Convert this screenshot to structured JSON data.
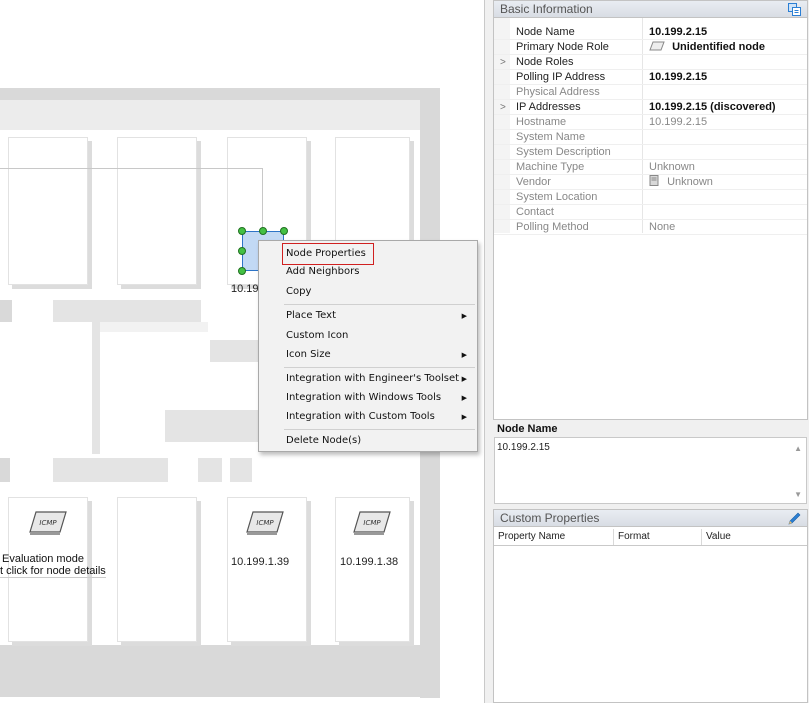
{
  "map": {
    "nodes": [
      {
        "label": "10.19",
        "selected": true
      },
      {
        "label": "10.199.1.39",
        "icon": "ICMP"
      },
      {
        "label": "10.199.1.38",
        "icon": "ICMP"
      },
      {
        "label": "",
        "icon": "ICMP"
      }
    ],
    "eval_line1": "Evaluation mode",
    "eval_line2": "t click for node details"
  },
  "context_menu": {
    "items": [
      {
        "label": "Node Properties",
        "highlighted": true,
        "submenu": false
      },
      {
        "label": "Add Neighbors",
        "submenu": false
      },
      {
        "label": "Copy",
        "submenu": false
      },
      {
        "label": "Place Text",
        "submenu": true
      },
      {
        "label": "Custom Icon",
        "submenu": false
      },
      {
        "label": "Icon Size",
        "submenu": true
      },
      {
        "label": "Integration with Engineer's Toolset",
        "submenu": true
      },
      {
        "label": "Integration with Windows Tools",
        "submenu": true
      },
      {
        "label": "Integration with Custom Tools",
        "submenu": true
      },
      {
        "label": "Delete Node(s)",
        "submenu": false
      }
    ],
    "submenu_arrow": "▶"
  },
  "basic_info": {
    "title": "Basic Information",
    "rows": [
      {
        "name": "Node Name",
        "value": "10.199.2.15",
        "expand": "",
        "style": "b"
      },
      {
        "name": "Primary Node Role",
        "value": "Unidentified node",
        "expand": "",
        "style": "b"
      },
      {
        "name": "Node Roles",
        "value": "",
        "expand": ">",
        "style": "n"
      },
      {
        "name": "Polling IP Address",
        "value": "10.199.2.15",
        "expand": "",
        "style": "b"
      },
      {
        "name": "Physical Address",
        "value": "",
        "expand": "",
        "style": "g"
      },
      {
        "name": "IP Addresses",
        "value": "10.199.2.15 (discovered)",
        "expand": ">",
        "style": "b"
      },
      {
        "name": "Hostname",
        "value": "10.199.2.15",
        "expand": "",
        "style": "g"
      },
      {
        "name": "System Name",
        "value": "",
        "expand": "",
        "style": "g"
      },
      {
        "name": "System Description",
        "value": "",
        "expand": "",
        "style": "g"
      },
      {
        "name": "Machine Type",
        "value": "Unknown",
        "expand": "",
        "style": "g"
      },
      {
        "name": "Vendor",
        "value": "Unknown",
        "expand": "",
        "style": "g"
      },
      {
        "name": "System Location",
        "value": "",
        "expand": "",
        "style": "g"
      },
      {
        "name": "Contact",
        "value": "",
        "expand": "",
        "style": "g"
      },
      {
        "name": "Polling Method",
        "value": "None",
        "expand": "",
        "style": "g"
      }
    ]
  },
  "node_name_panel": {
    "title": "Node Name",
    "value": "10.199.2.15"
  },
  "custom_properties": {
    "title": "Custom Properties",
    "columns": [
      "Property Name",
      "Format",
      "Value"
    ]
  },
  "colors": {
    "accent_blue": "#2b7fd4",
    "highlight_red": "#d02020",
    "selection_green": "#44c044"
  }
}
